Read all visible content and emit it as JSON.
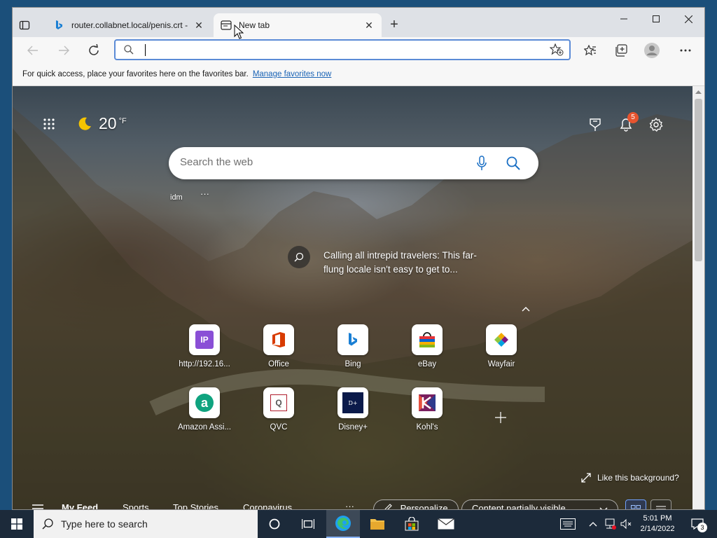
{
  "browser": {
    "tabs": [
      {
        "title": "router.collabnet.local/penis.crt -"
      },
      {
        "title": "New tab"
      }
    ],
    "address": {
      "value": ""
    },
    "favorites_bar": {
      "message": "For quick access, place your favorites here on the favorites bar.",
      "link": "Manage favorites now"
    }
  },
  "newtab": {
    "weather": {
      "temp": "20",
      "unit": "°F"
    },
    "notifications_count": "5",
    "search": {
      "placeholder": "Search the web"
    },
    "profile_label": "idm",
    "profile_more": "···",
    "image_caption": "Calling all intrepid travelers: This far-flung locale isn't easy to get to...",
    "quick_links": [
      {
        "label": "http://192.16...",
        "icon": "ip-icon",
        "color": "#8a4fd6"
      },
      {
        "label": "Office",
        "icon": "office-icon",
        "color": "#d83b01"
      },
      {
        "label": "Bing",
        "icon": "bing-icon",
        "color": "#1a7fd4"
      },
      {
        "label": "eBay",
        "icon": "ebay-icon",
        "color": "#1a1a1a"
      },
      {
        "label": "Wayfair",
        "icon": "wayfair-icon",
        "color": "#7f187f"
      },
      {
        "label": "Amazon Assi...",
        "icon": "amazon-assistant-icon",
        "color": "#0fa37f"
      },
      {
        "label": "QVC",
        "icon": "qvc-icon",
        "color": "#b11e2e"
      },
      {
        "label": "Disney+",
        "icon": "disney-plus-icon",
        "color": "#0b1a4a"
      },
      {
        "label": "Kohl's",
        "icon": "kohls-icon",
        "color": "#7a1f5f"
      }
    ],
    "like_background": "Like this background?",
    "feed": {
      "tabs": [
        "My Feed",
        "Sports",
        "Top Stories",
        "Coronavirus"
      ],
      "more": "···",
      "personalize": "Personalize",
      "content_visibility": "Content partially visible"
    }
  },
  "taskbar": {
    "search_placeholder": "Type here to search",
    "time": "5:01 PM",
    "date": "2/14/2022",
    "notification_count": "3"
  }
}
